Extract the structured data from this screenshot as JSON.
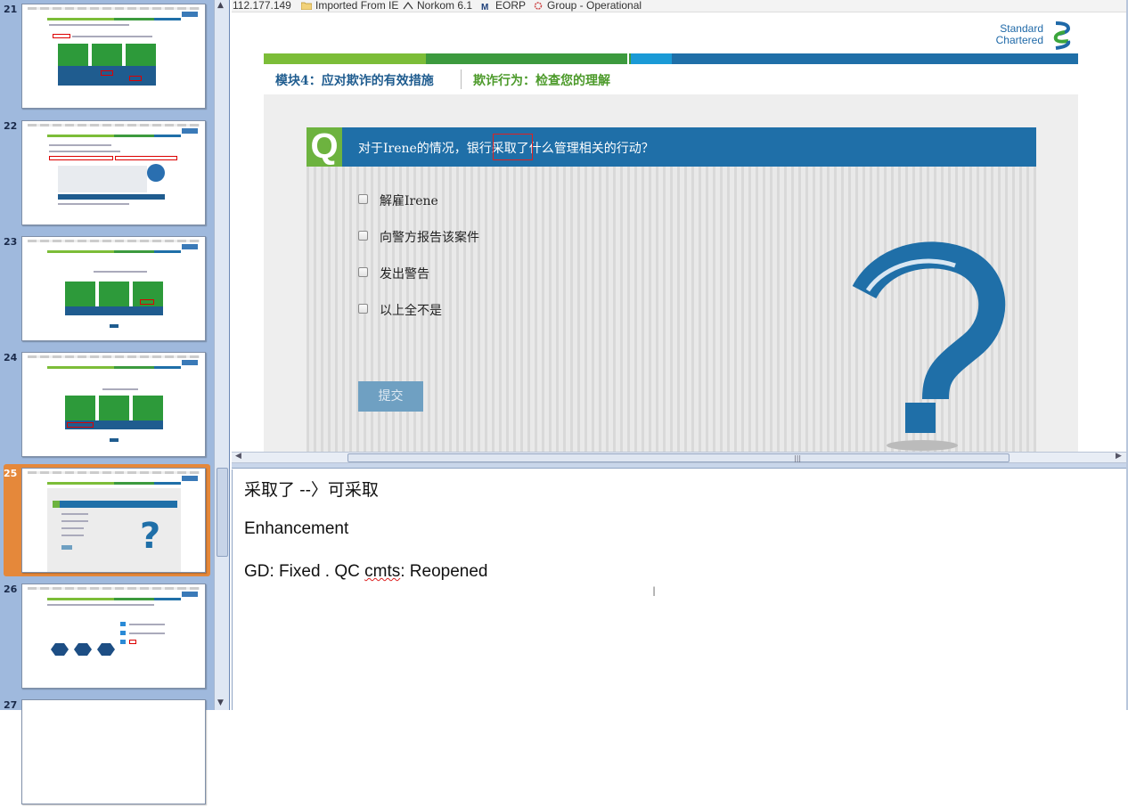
{
  "browser_bar": {
    "address": "112.177.149",
    "bookmarks": [
      {
        "label": "Imported From IE",
        "icon": "folder-icon"
      },
      {
        "label": "Norkom 6.1",
        "icon": "norkom-icon"
      },
      {
        "label": "EORP",
        "icon": "eorp-icon"
      },
      {
        "label": "Group - Operational",
        "icon": "group-icon"
      }
    ]
  },
  "thumbnails": [
    {
      "number": "21",
      "selected": false
    },
    {
      "number": "22",
      "selected": false
    },
    {
      "number": "23",
      "selected": false
    },
    {
      "number": "24",
      "selected": false
    },
    {
      "number": "25",
      "selected": true
    },
    {
      "number": "26",
      "selected": false
    },
    {
      "number": "27",
      "selected": false
    }
  ],
  "slide": {
    "logo_line1": "Standard",
    "logo_line2": "Chartered",
    "module_title": "模块4：应对欺诈的有效措施",
    "section_title": "欺诈行为：检查您的理解",
    "question_badge": "Q",
    "question": "对于Irene的情况，银行采取了什么管理相关的行动？",
    "options": [
      "解雇Irene",
      "向警方报告该案件",
      "发出警告",
      "以上全不是"
    ],
    "submit_label": "提交",
    "colors": {
      "green_light": "#7cbd38",
      "green_dark": "#3c9a3e",
      "blue": "#1f6fa8",
      "cyan": "#1a9ad6",
      "highlight_red": "#d22222"
    }
  },
  "notes": {
    "line1": "采取了 --〉可采取",
    "line2": "Enhancement",
    "line3_prefix": "GD: Fixed . QC ",
    "line3_spell": "cmts",
    "line3_suffix": ": Reopened"
  }
}
